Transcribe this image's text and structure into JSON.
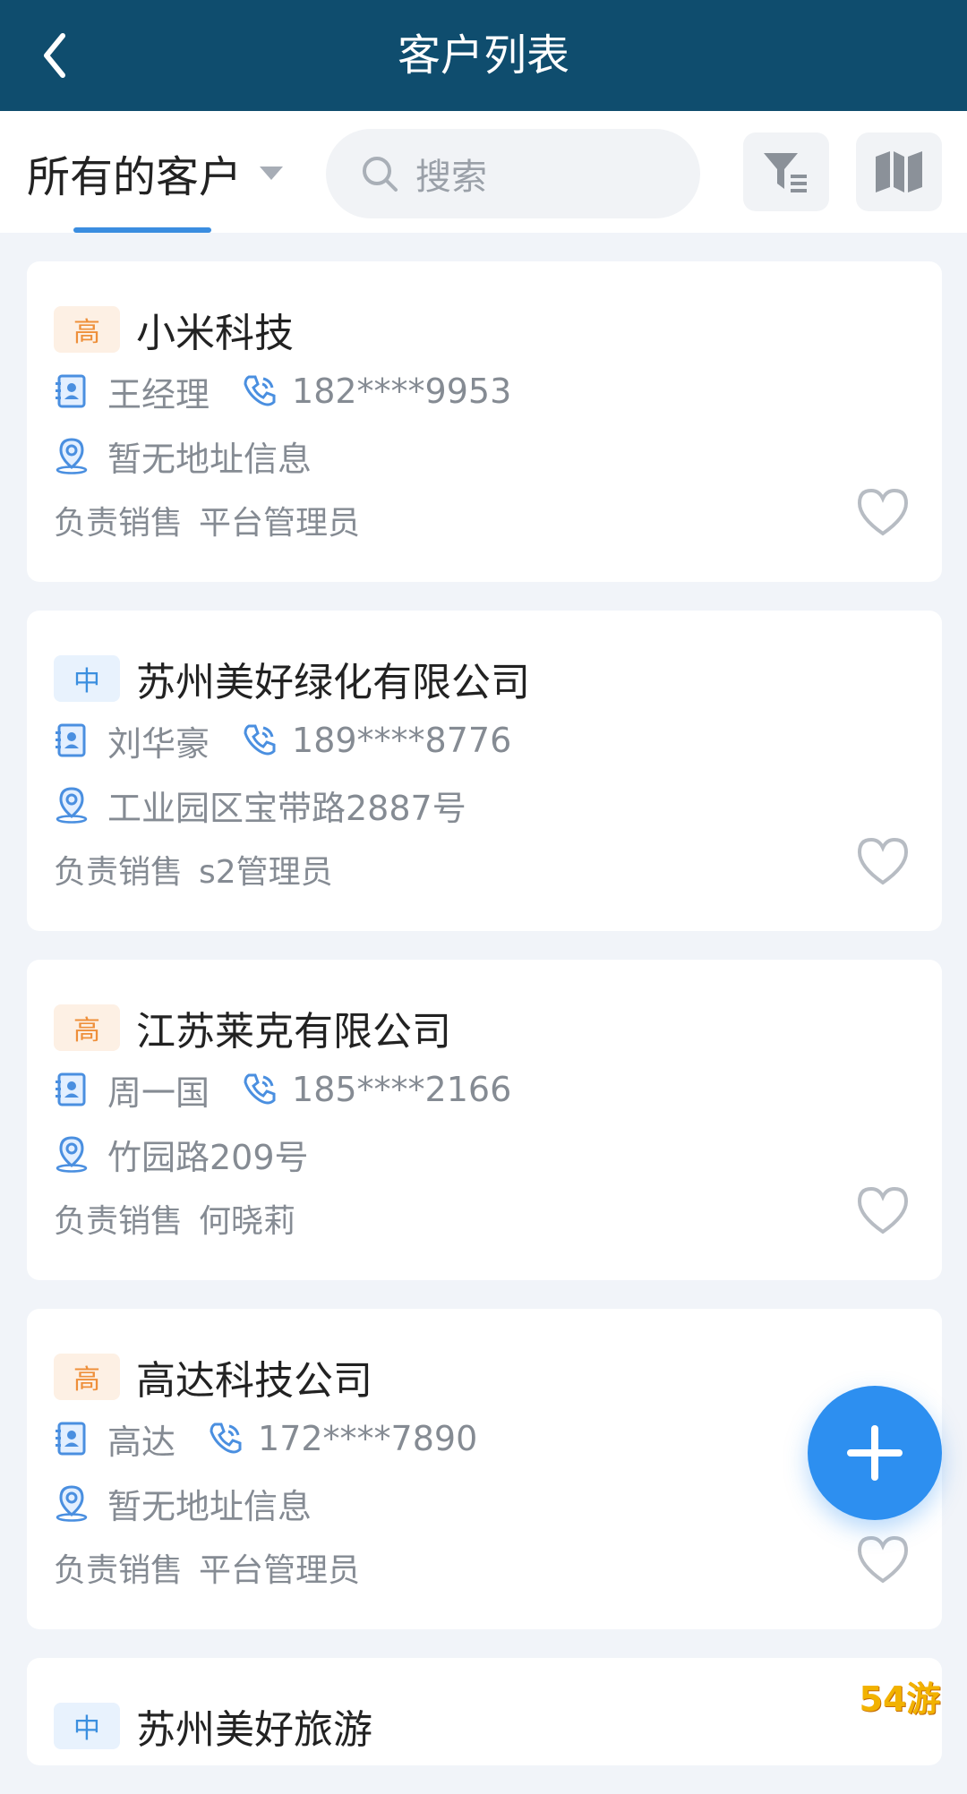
{
  "header": {
    "title": "客户列表"
  },
  "toolbar": {
    "scope_label": "所有的客户",
    "search_placeholder": "搜索"
  },
  "customers": [
    {
      "level": "高",
      "level_type": "high",
      "name": "小米科技",
      "contact": "王经理",
      "phone": "182****9953",
      "address": "暂无地址信息",
      "sales_label": "负责销售",
      "sales": "平台管理员"
    },
    {
      "level": "中",
      "level_type": "mid",
      "name": "苏州美好绿化有限公司",
      "contact": "刘华豪",
      "phone": "189****8776",
      "address": "工业园区宝带路2887号",
      "sales_label": "负责销售",
      "sales": "s2管理员"
    },
    {
      "level": "高",
      "level_type": "high",
      "name": "江苏莱克有限公司",
      "contact": "周一国",
      "phone": "185****2166",
      "address": "竹园路209号",
      "sales_label": "负责销售",
      "sales": "何晓莉"
    },
    {
      "level": "高",
      "level_type": "high",
      "name": "高达科技公司",
      "contact": "高达",
      "phone": "172****7890",
      "address": "暂无地址信息",
      "sales_label": "负责销售",
      "sales": "平台管理员"
    },
    {
      "level": "中",
      "level_type": "mid",
      "name": "苏州美好旅游"
    }
  ],
  "watermark": "54游",
  "colors": {
    "header": "#0f4d6e",
    "accent": "#2d8ff0",
    "high": "#ee8f3a",
    "mid": "#3b8fdf"
  },
  "icons": [
    "back-icon",
    "search-icon",
    "filter-icon",
    "map-icon",
    "contact-card-icon",
    "phone-icon",
    "location-icon",
    "heart-icon",
    "plus-icon"
  ]
}
